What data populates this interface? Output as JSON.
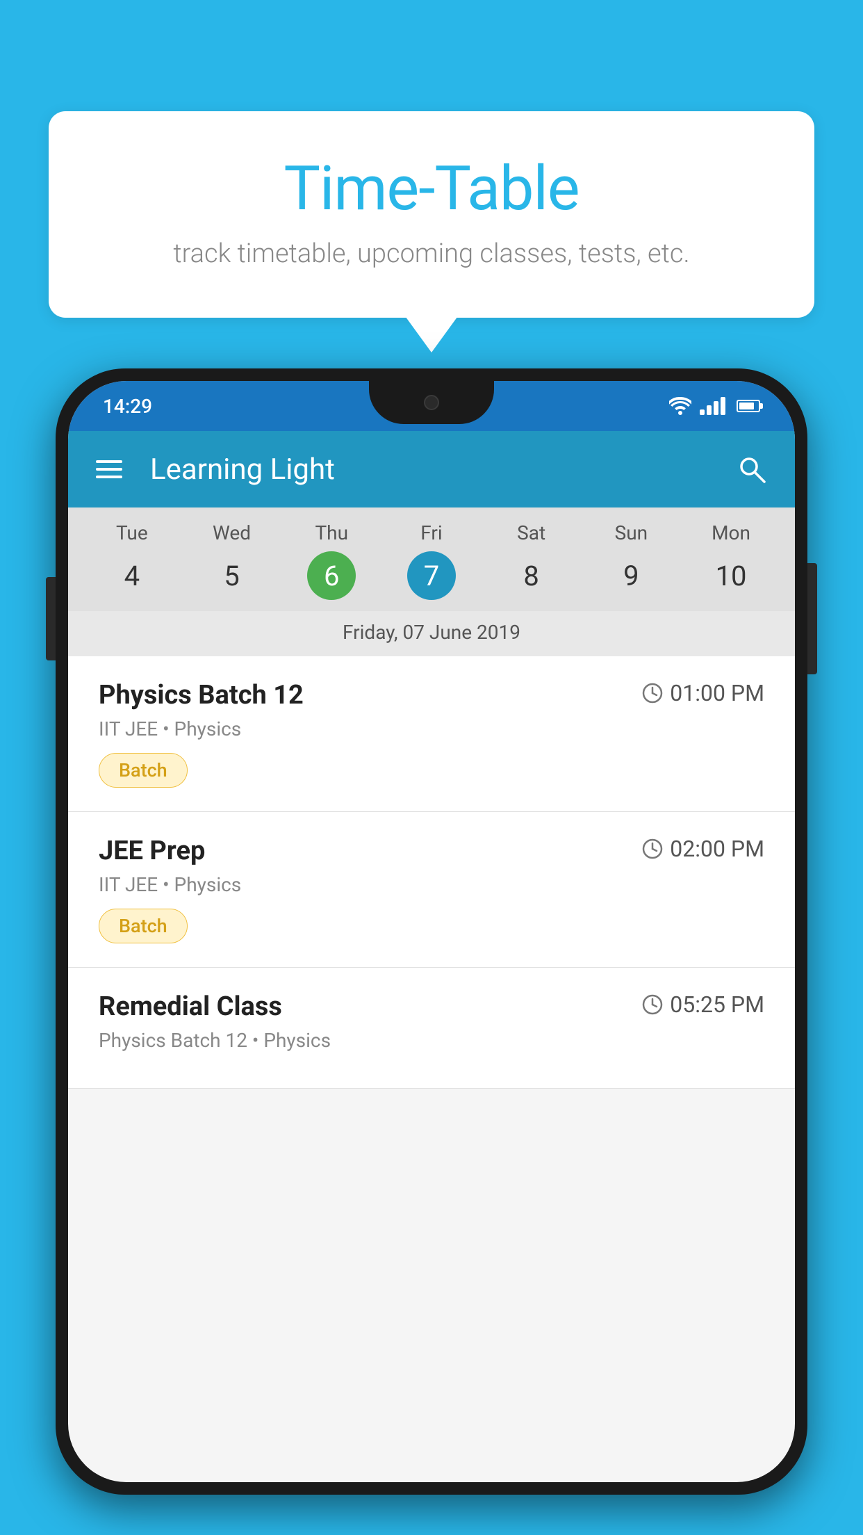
{
  "background_color": "#29b6e8",
  "bubble": {
    "title": "Time-Table",
    "subtitle": "track timetable, upcoming classes, tests, etc."
  },
  "phone": {
    "status_bar": {
      "time": "14:29"
    },
    "app_bar": {
      "title": "Learning Light"
    },
    "calendar": {
      "days": [
        {
          "label": "Tue",
          "number": "4",
          "state": "normal"
        },
        {
          "label": "Wed",
          "number": "5",
          "state": "normal"
        },
        {
          "label": "Thu",
          "number": "6",
          "state": "today"
        },
        {
          "label": "Fri",
          "number": "7",
          "state": "selected"
        },
        {
          "label": "Sat",
          "number": "8",
          "state": "normal"
        },
        {
          "label": "Sun",
          "number": "9",
          "state": "normal"
        },
        {
          "label": "Mon",
          "number": "10",
          "state": "normal"
        }
      ],
      "selected_date": "Friday, 07 June 2019"
    },
    "schedule_items": [
      {
        "title": "Physics Batch 12",
        "time": "01:00 PM",
        "subtitle": "IIT JEE • Physics",
        "tag": "Batch"
      },
      {
        "title": "JEE Prep",
        "time": "02:00 PM",
        "subtitle": "IIT JEE • Physics",
        "tag": "Batch"
      },
      {
        "title": "Remedial Class",
        "time": "05:25 PM",
        "subtitle": "Physics Batch 12 • Physics",
        "tag": ""
      }
    ]
  }
}
